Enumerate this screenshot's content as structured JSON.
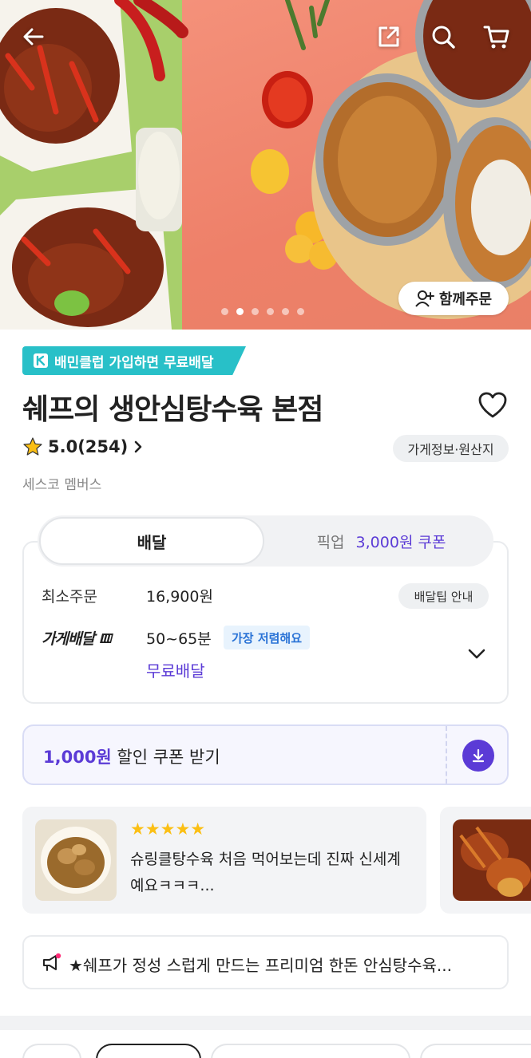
{
  "hero": {
    "back_icon": "arrow-left-icon",
    "share_icon": "share-icon",
    "search_icon": "search-icon",
    "cart_icon": "cart-icon",
    "together_label": "함께주문",
    "together_icon": "add-person-icon",
    "carousel_pages": 6,
    "carousel_active": 1
  },
  "store": {
    "club_badge": "배민클럽 가입하면 무료배달",
    "title": "쉐프의 생안심탕수육 본점",
    "rating": "5.0",
    "review_count": "(254)",
    "info_chip": "가게정보·원산지",
    "subtitle": "세스코 멤버스"
  },
  "delivery": {
    "tab_delivery": "배달",
    "tab_pickup": "픽업",
    "pickup_coupon": "3,000원 쿠폰",
    "min_order_label": "최소주문",
    "min_order_value": "16,900원",
    "tip_chip": "배달팁 안내",
    "brand_label": "가게배달",
    "time_value": "50~65분",
    "cheapest_badge": "가장 저렴해요",
    "free_delivery": "무료배달"
  },
  "coupon": {
    "amount": "1,000원",
    "text": " 할인 쿠폰 받기"
  },
  "reviews": [
    {
      "stars": "★★★★★",
      "text": "슈링클탕수육 처음 먹어보는데 진짜 신세계예요ㅋㅋㅋ..."
    }
  ],
  "notice": {
    "text": "★쉐프가 정성 스럽게 만드는 프리미엄 한돈 안심탕수육..."
  },
  "colors": {
    "accent": "#5b3bd6",
    "club": "#28c0c8",
    "star": "#fbbf14"
  }
}
